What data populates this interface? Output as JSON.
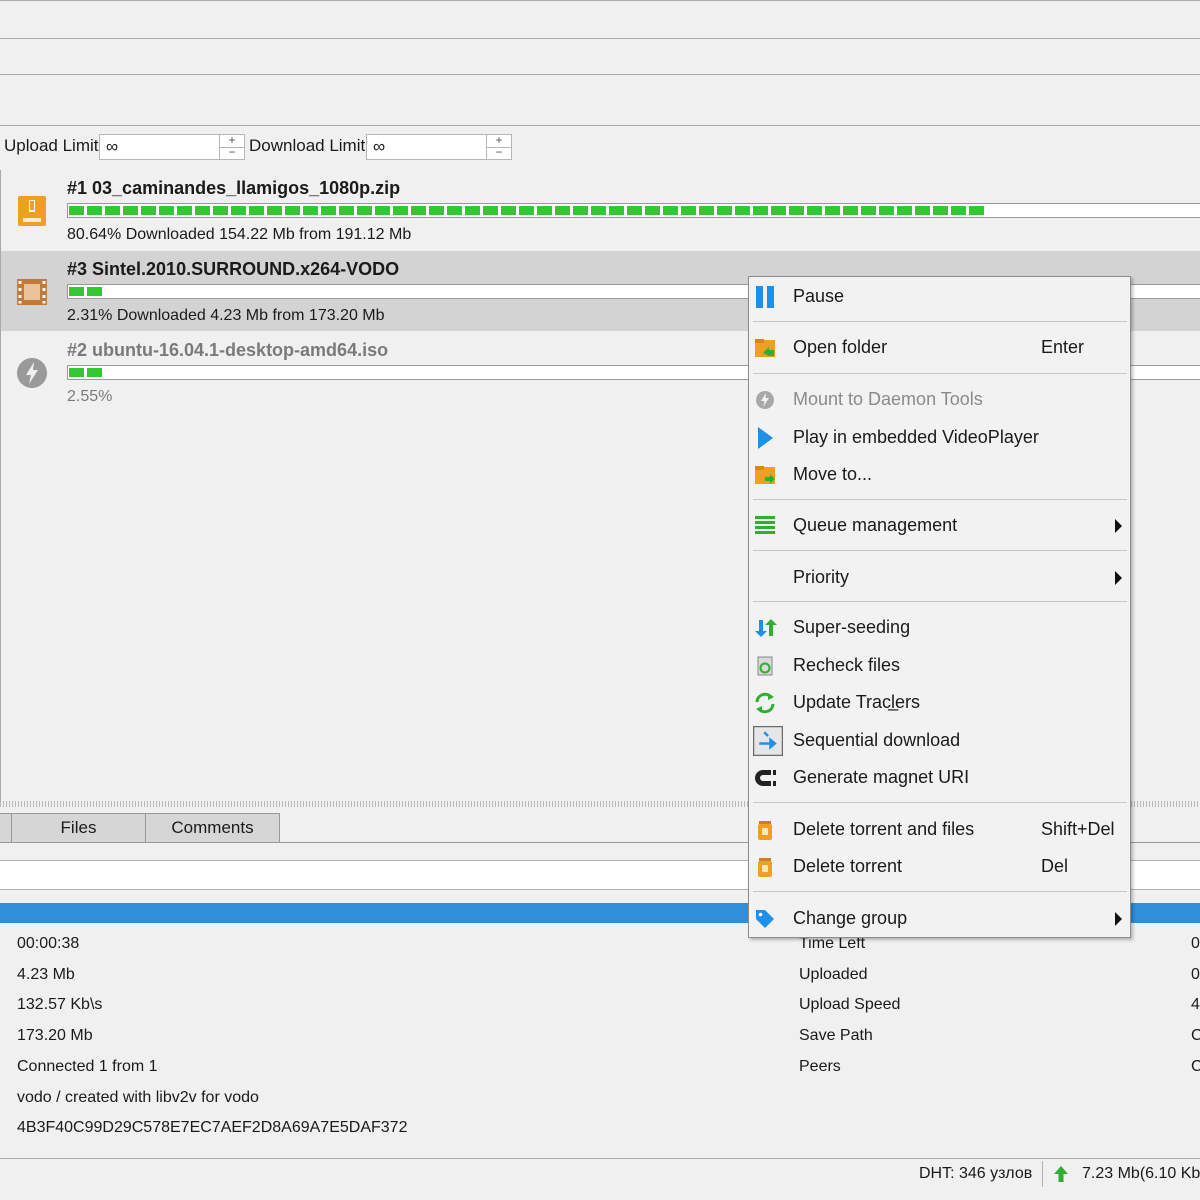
{
  "limits": {
    "upload_label": "Upload Limit",
    "upload_value": "∞",
    "download_label": "Download Limit",
    "download_value": "∞"
  },
  "torrents": [
    {
      "name": "#1 03_caminandes_llamigos_1080p.zip",
      "status": "80.64% Downloaded 154.22 Mb from 191.12 Mb",
      "progress_percent": 80.64
    },
    {
      "name": "#3 Sintel.2010.SURROUND.x264-VODO",
      "status": "2.31% Downloaded 4.23 Mb from 173.20 Mb",
      "progress_percent": 2.31
    },
    {
      "name": "#2 ubuntu-16.04.1-desktop-amd64.iso",
      "status": "2.55%",
      "progress_percent": 2.55
    }
  ],
  "tabs": {
    "files": "Files",
    "comments": "Comments"
  },
  "info_left": [
    "00:00:38",
    "4.23 Mb",
    "132.57 Kb\\s",
    "173.20 Mb",
    "Connected 1 from 1",
    "vodo / created with libv2v for vodo",
    "4B3F40C99D29C578E7EC7AEF2D8A69A7E5DAF372"
  ],
  "info_right_labels": [
    "Time Left",
    "Uploaded",
    "Upload Speed",
    "Save Path",
    "Peers"
  ],
  "info_right_values": [
    "0",
    "0",
    "4",
    "C",
    "C"
  ],
  "statusbar": {
    "dht": "DHT: 346 узлов",
    "speed": "7.23 Mb(6.10 Kb"
  },
  "menu": {
    "pause": "Pause",
    "open_folder": "Open folder",
    "open_folder_shortcut": "Enter",
    "mount_daemon": "Mount to Daemon Tools",
    "play_embedded": "Play in embedded VideoPlayer",
    "move_to": "Move to...",
    "queue_management": "Queue management",
    "priority": "Priority",
    "super_seeding": "Super-seeding",
    "recheck_files": "Recheck files",
    "update_trackers": "Update Tracl̲ers",
    "sequential_download": "Sequential download",
    "generate_magnet": "Generate magnet URI",
    "delete_torrent_files": "Delete torrent and files",
    "delete_torrent_files_shortcut": "Shift+Del",
    "delete_torrent": "Delete torrent",
    "delete_torrent_shortcut": "Del",
    "change_group": "Change group"
  },
  "colors": {
    "accent_blue": "#2f8fdb",
    "progress_green": "#32c832",
    "selected_row": "#d3d3d3",
    "folder_orange": "#f0a020"
  }
}
